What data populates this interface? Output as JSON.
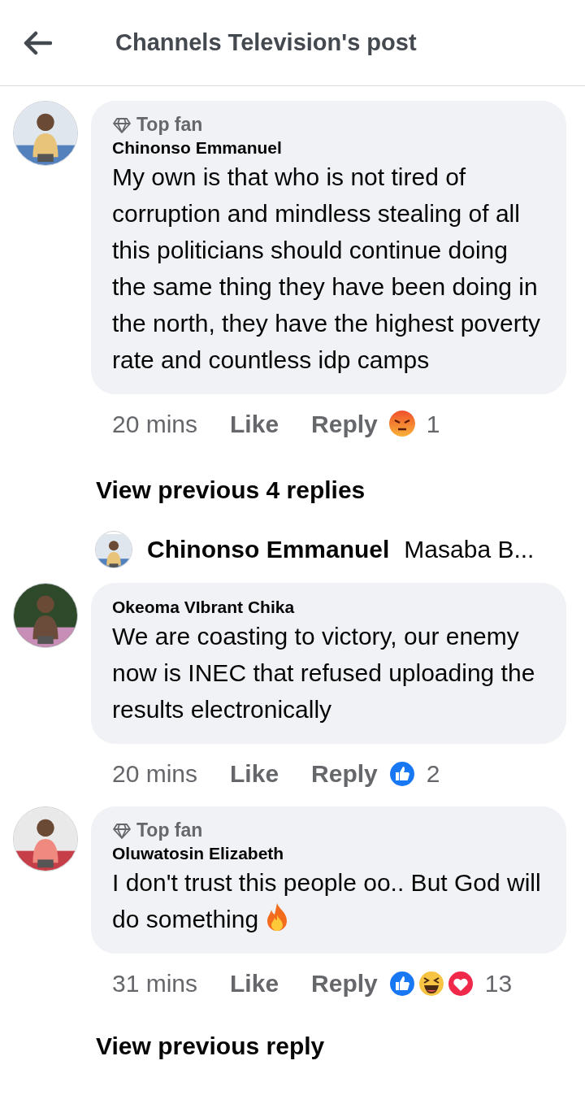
{
  "header": {
    "title": "Channels Television's post"
  },
  "comments": [
    {
      "kind": "comment",
      "badge": "Top fan",
      "author": "Chinonso Emmanuel",
      "text": "My own is that who is not tired of corruption and mindless stealing of all this politicians should continue doing the same thing they have been doing in the north, they have the highest poverty rate and countless idp camps",
      "time": "20 mins",
      "like": "Like",
      "reply": "Reply",
      "reactions": [
        {
          "kind": "angry"
        }
      ],
      "reaction_count": "1"
    },
    {
      "kind": "view_replies",
      "label": "View previous 4 replies"
    },
    {
      "kind": "reply_preview",
      "author": "Chinonso Emmanuel",
      "text": "Masaba B..."
    },
    {
      "kind": "comment",
      "author": "Okeoma VIbrant Chika",
      "text": "We are coasting to victory, our enemy now is INEC that refused uploading the results electronically",
      "time": "20 mins",
      "like": "Like",
      "reply": "Reply",
      "reactions": [
        {
          "kind": "like"
        }
      ],
      "reaction_count": "2"
    },
    {
      "kind": "comment",
      "badge": "Top fan",
      "author": "Oluwatosin Elizabeth",
      "text": "I don't trust this people oo.. But God will do something",
      "trailing_icon": {
        "kind": "fire"
      },
      "time": "31 mins",
      "like": "Like",
      "reply": "Reply",
      "reactions": [
        {
          "kind": "like"
        },
        {
          "kind": "haha"
        },
        {
          "kind": "love"
        }
      ],
      "reaction_count": "13"
    },
    {
      "kind": "view_replies",
      "label": "View previous reply"
    }
  ]
}
